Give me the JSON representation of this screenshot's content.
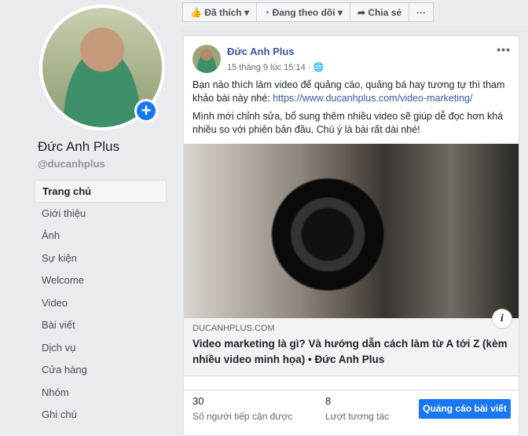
{
  "profile": {
    "name": "Đức Anh Plus",
    "handle": "@ducanhplus",
    "add_icon": "plus-icon"
  },
  "nav": [
    {
      "label": "Trang chủ",
      "active": true
    },
    {
      "label": "Giới thiệu"
    },
    {
      "label": "Ảnh"
    },
    {
      "label": "Sự kiện"
    },
    {
      "label": "Welcome"
    },
    {
      "label": "Video"
    },
    {
      "label": "Bài viết"
    },
    {
      "label": "Dịch vụ"
    },
    {
      "label": "Cửa hàng"
    },
    {
      "label": "Nhóm"
    },
    {
      "label": "Ghi chú"
    }
  ],
  "actions": {
    "liked": "Đã thích",
    "following": "Đang theo dõi",
    "share": "Chia sẻ",
    "more": "···"
  },
  "post": {
    "author": "Đức Anh Plus",
    "time": "15 tháng 9 lúc 15:14 ·",
    "text1": "Bạn nào thích làm video để quảng cáo, quảng bá hay tương tự thì tham khảo bài này nhé: ",
    "link": "https://www.ducanhplus.com/video-marketing/",
    "text2": "Mình mới chỉnh sửa, bổ sung thêm nhiều video sẽ giúp dễ đọc hơn khá nhiều so với phiên bản đầu. Chú ý là bài rất dài nhé!",
    "more": "•••",
    "preview": {
      "domain": "DUCANHPLUS.COM",
      "title": "Video marketing là gì? Và hướng dẫn cách làm từ A tới Z (kèm nhiều video minh họa) • Đức Anh Plus",
      "info": "i"
    },
    "stats": {
      "reach": "30",
      "reach_label": "Số người tiếp cận được",
      "engagement": "8",
      "engagement_label": "Lượt tương tác"
    },
    "boost": "Quảng cáo bài viết"
  }
}
